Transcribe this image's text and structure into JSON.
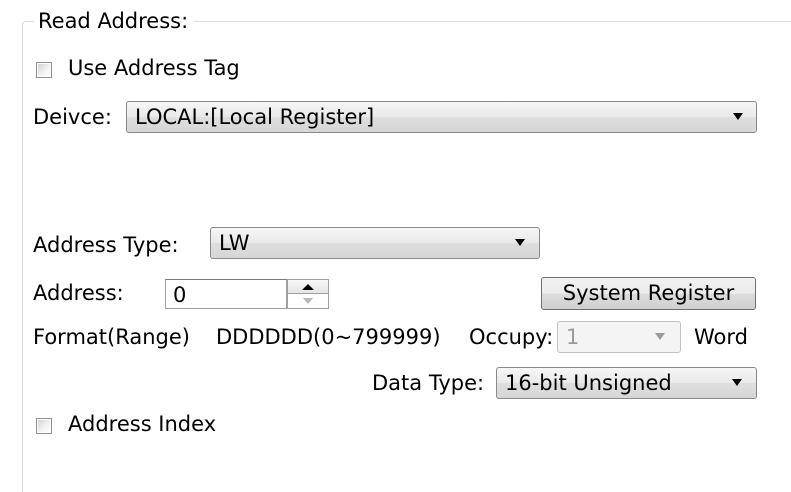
{
  "read_address": {
    "group_title": "Read Address:",
    "use_address_tag": {
      "label": "Use Address Tag",
      "checked": false
    },
    "device": {
      "label": "Deivce:",
      "value": "LOCAL:[Local Register]"
    },
    "address_type": {
      "label": "Address Type:",
      "value": "LW"
    },
    "address": {
      "label": "Address:",
      "value": "0"
    },
    "system_register_button": "System Register",
    "format": {
      "label": "Format(Range)",
      "value": "DDDDDD(0~799999)"
    },
    "occupy": {
      "label": "Occupy:",
      "value": "1",
      "unit": "Word",
      "disabled": true
    },
    "data_type": {
      "label": "Data Type:",
      "value": "16-bit Unsigned"
    },
    "address_index": {
      "label": "Address Index",
      "checked": false
    }
  }
}
